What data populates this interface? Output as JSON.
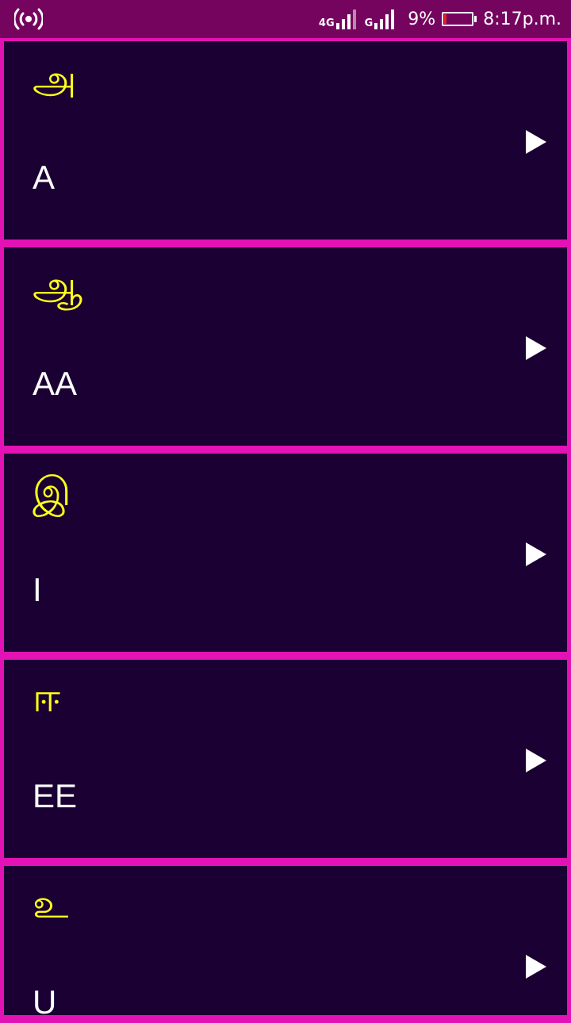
{
  "status_bar": {
    "network_4g": "4G",
    "network_g": "G",
    "battery_percent": "9%",
    "battery_level": 0.09,
    "time": "8:17p.m.",
    "icons": [
      "hotspot-icon",
      "signal-icon",
      "battery-icon"
    ]
  },
  "letters": [
    {
      "tamil": "அ",
      "latin": "A"
    },
    {
      "tamil": "ஆ",
      "latin": "AA"
    },
    {
      "tamil": "இ",
      "latin": "I"
    },
    {
      "tamil": "ஈ",
      "latin": "EE"
    },
    {
      "tamil": "உ",
      "latin": "U"
    }
  ],
  "colors": {
    "status_bar_bg": "#75045f",
    "item_bg": "#1a0033",
    "divider": "#e312b4",
    "tamil_text": "#ffff19",
    "latin_text": "#ffffff",
    "battery_low": "#e0202a"
  }
}
